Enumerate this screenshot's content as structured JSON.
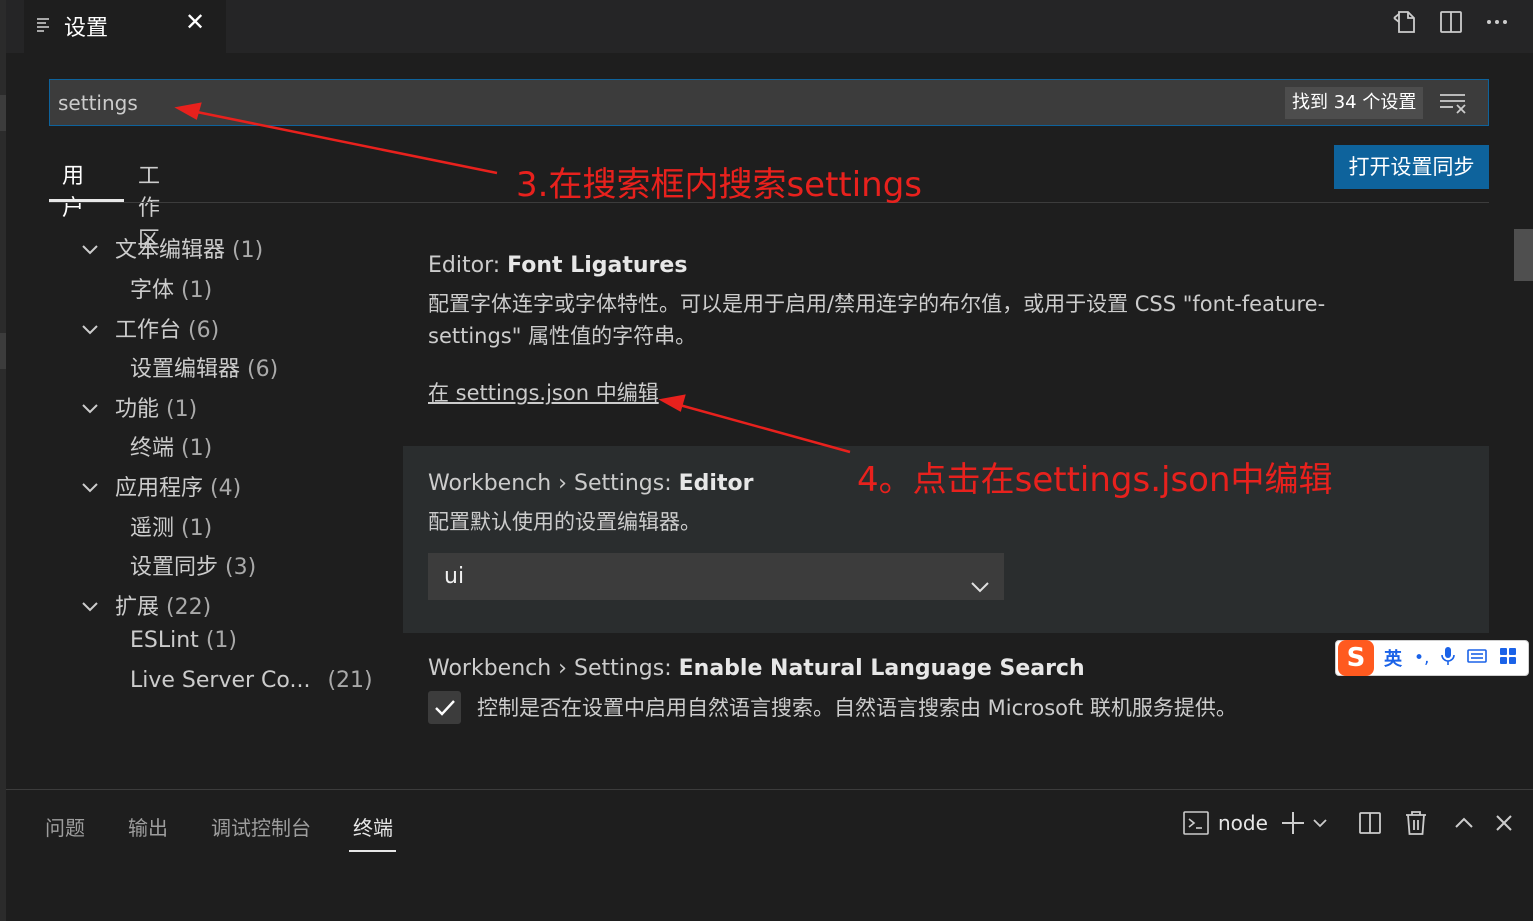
{
  "editor_tab": {
    "icon": "settings-list-icon",
    "title": "设置",
    "close": "✕"
  },
  "editor_actions": [
    "open-settings-json-icon",
    "split-editor-icon",
    "more-actions-icon"
  ],
  "search": {
    "value": "settings",
    "placeholder": "",
    "result_count": "找到 34 个设置",
    "filter_icon": "filter-icon"
  },
  "scope_tabs": [
    {
      "label": "用户",
      "active": true
    },
    {
      "label": "工作区",
      "active": false
    }
  ],
  "sync_button": "打开设置同步",
  "toc": [
    {
      "label": "文本编辑器",
      "count": "(1)",
      "level": 0,
      "expanded": true
    },
    {
      "label": "字体",
      "count": "(1)",
      "level": 1
    },
    {
      "label": "工作台",
      "count": "(6)",
      "level": 0,
      "expanded": true
    },
    {
      "label": "设置编辑器",
      "count": "(6)",
      "level": 1
    },
    {
      "label": "功能",
      "count": "(1)",
      "level": 0,
      "expanded": true
    },
    {
      "label": "终端",
      "count": "(1)",
      "level": 1
    },
    {
      "label": "应用程序",
      "count": "(4)",
      "level": 0,
      "expanded": true
    },
    {
      "label": "遥测",
      "count": "(1)",
      "level": 1
    },
    {
      "label": "设置同步",
      "count": "(3)",
      "level": 1
    },
    {
      "label": "扩展",
      "count": "(22)",
      "level": 0,
      "expanded": true
    },
    {
      "label": "ESLint",
      "count": "(1)",
      "level": 1
    },
    {
      "label": "Live Server Co...",
      "count": "(21)",
      "level": 1
    }
  ],
  "settings": [
    {
      "category": "Editor: ",
      "name": "Font Ligatures",
      "description_line1": "配置字体连字或字体特性。可以是用于启用/禁用连字的布尔值，或用于设置 CSS \"font-feature-",
      "description_line2": "settings\" 属性值的字符串。",
      "link": "在 settings.json 中编辑"
    },
    {
      "category": "Workbench › Settings: ",
      "name": "Editor",
      "description": "配置默认使用的设置编辑器。",
      "value": "ui"
    },
    {
      "category": "Workbench › Settings: ",
      "name": "Enable Natural Language Search",
      "description": "控制是否在设置中启用自然语言搜索。自然语言搜索由 Microsoft 联机服务提供。",
      "checked": true
    }
  ],
  "annotations": {
    "step3": "3.在搜索框内搜索settings",
    "step4": "4。点击在settings.json中编辑",
    "color": "#e8211d"
  },
  "ime": {
    "logo": "S",
    "lang": "英",
    "icons": [
      "punctuation-icon",
      "microphone-icon",
      "keyboard-icon",
      "toolbox-icon"
    ]
  },
  "panel": {
    "tabs": [
      {
        "label": "问题",
        "active": false
      },
      {
        "label": "输出",
        "active": false
      },
      {
        "label": "调试控制台",
        "active": false
      },
      {
        "label": "终端",
        "active": true
      }
    ],
    "terminal_name": "node"
  },
  "colors": {
    "accent": "#0e639c",
    "background": "#1e1e1e",
    "sidebar": "#252526",
    "input": "#3c3c3c"
  }
}
